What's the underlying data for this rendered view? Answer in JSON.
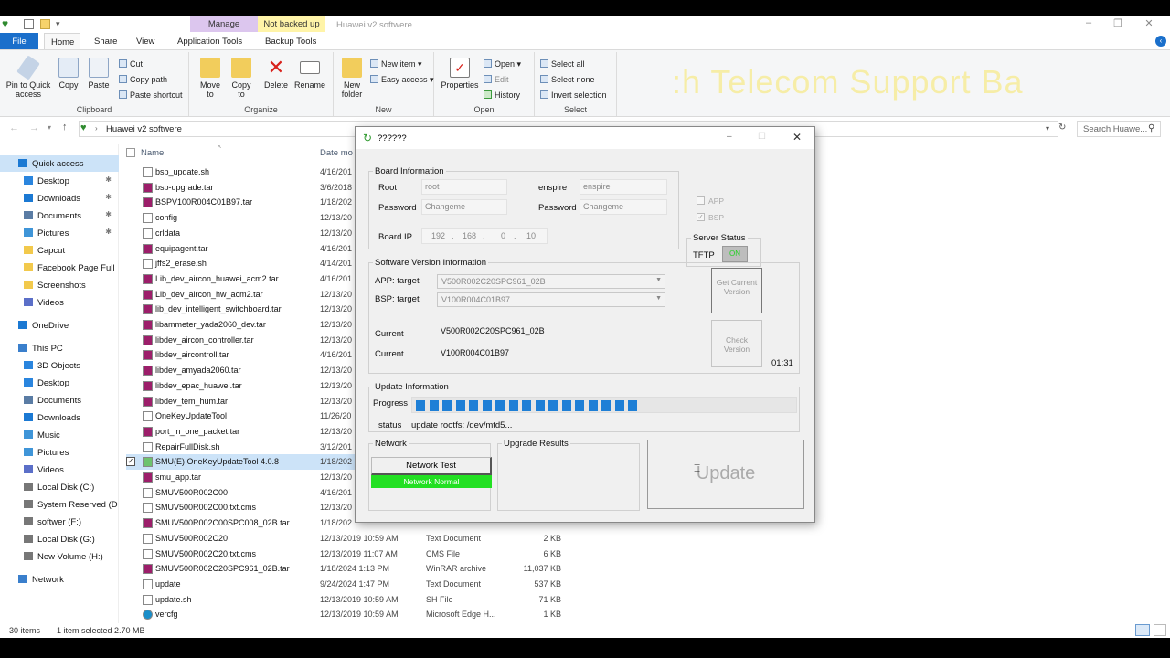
{
  "window": {
    "title": "Huawei v2 softwere",
    "ctx_manage": "Manage",
    "ctx_not_backed": "Not backed up"
  },
  "ribbon": {
    "tabs": [
      "File",
      "Home",
      "Share",
      "View",
      "Application Tools",
      "Backup Tools"
    ],
    "clipboard": {
      "label": "Clipboard",
      "pin": "Pin to Quick access",
      "copy": "Copy",
      "paste": "Paste",
      "cut": "Cut",
      "copy_path": "Copy path",
      "paste_shortcut": "Paste shortcut"
    },
    "organize": {
      "label": "Organize",
      "move": "Move to",
      "copy": "Copy to",
      "delete": "Delete",
      "rename": "Rename"
    },
    "new": {
      "label": "New",
      "folder": "New folder",
      "item": "New item",
      "easy": "Easy access"
    },
    "open": {
      "label": "Open",
      "properties": "Properties",
      "open": "Open",
      "edit": "Edit",
      "history": "History"
    },
    "select": {
      "label": "Select",
      "all": "Select all",
      "none": "Select none",
      "invert": "Invert selection"
    },
    "banner": ":h Telecom Support  Ba"
  },
  "address": {
    "path": "Huawei v2 softwere",
    "search_placeholder": "Search Huawe..."
  },
  "nav": [
    {
      "label": "Quick access",
      "kind": "star",
      "indent": 0,
      "sel": true
    },
    {
      "label": "Desktop",
      "kind": "blue",
      "indent": 1,
      "pin": true
    },
    {
      "label": "Downloads",
      "kind": "down",
      "indent": 1,
      "pin": true
    },
    {
      "label": "Documents",
      "kind": "doc",
      "indent": 1,
      "pin": true
    },
    {
      "label": "Pictures",
      "kind": "pic",
      "indent": 1,
      "pin": true
    },
    {
      "label": "Capcut",
      "kind": "folder",
      "indent": 1
    },
    {
      "label": "Facebook Page Full",
      "kind": "folder",
      "indent": 1
    },
    {
      "label": "Screenshots",
      "kind": "folder",
      "indent": 1
    },
    {
      "label": "Videos",
      "kind": "vid",
      "indent": 1
    },
    {
      "label": "",
      "kind": "gap",
      "indent": 0
    },
    {
      "label": "OneDrive",
      "kind": "cloud",
      "indent": 0
    },
    {
      "label": "",
      "kind": "gap",
      "indent": 0
    },
    {
      "label": "This PC",
      "kind": "pc",
      "indent": 0
    },
    {
      "label": "3D Objects",
      "kind": "blue",
      "indent": 1
    },
    {
      "label": "Desktop",
      "kind": "blue",
      "indent": 1
    },
    {
      "label": "Documents",
      "kind": "doc",
      "indent": 1
    },
    {
      "label": "Downloads",
      "kind": "down",
      "indent": 1
    },
    {
      "label": "Music",
      "kind": "music",
      "indent": 1
    },
    {
      "label": "Pictures",
      "kind": "pic",
      "indent": 1
    },
    {
      "label": "Videos",
      "kind": "vid",
      "indent": 1
    },
    {
      "label": "Local Disk (C:)",
      "kind": "disk",
      "indent": 1
    },
    {
      "label": "System Reserved (D",
      "kind": "disk",
      "indent": 1
    },
    {
      "label": "softwer (F:)",
      "kind": "disk",
      "indent": 1
    },
    {
      "label": "Local Disk (G:)",
      "kind": "disk",
      "indent": 1
    },
    {
      "label": "New Volume (H:)",
      "kind": "disk",
      "indent": 1
    },
    {
      "label": "",
      "kind": "gap",
      "indent": 0
    },
    {
      "label": "Network",
      "kind": "net",
      "indent": 0
    }
  ],
  "list": {
    "col_name": "Name",
    "col_date": "Date mo",
    "files": [
      {
        "name": "bsp_update.sh",
        "date": "4/16/201",
        "type": "",
        "size": "",
        "kind": "sh"
      },
      {
        "name": "bsp-upgrade.tar",
        "date": "3/6/2018",
        "type": "",
        "size": "",
        "kind": "rar"
      },
      {
        "name": "BSPV100R004C01B97.tar",
        "date": "1/18/202",
        "type": "",
        "size": "",
        "kind": "rar"
      },
      {
        "name": "config",
        "date": "12/13/20",
        "type": "",
        "size": "",
        "kind": "file"
      },
      {
        "name": "crldata",
        "date": "12/13/20",
        "type": "",
        "size": "",
        "kind": "file"
      },
      {
        "name": "equipagent.tar",
        "date": "4/16/201",
        "type": "",
        "size": "",
        "kind": "rar"
      },
      {
        "name": "jffs2_erase.sh",
        "date": "4/14/201",
        "type": "",
        "size": "",
        "kind": "sh"
      },
      {
        "name": "Lib_dev_aircon_huawei_acm2.tar",
        "date": "4/16/201",
        "type": "",
        "size": "",
        "kind": "rar"
      },
      {
        "name": "Lib_dev_aircon_hw_acm2.tar",
        "date": "12/13/20",
        "type": "",
        "size": "",
        "kind": "rar"
      },
      {
        "name": "lib_dev_intelligent_switchboard.tar",
        "date": "12/13/20",
        "type": "",
        "size": "",
        "kind": "rar"
      },
      {
        "name": "libammeter_yada2060_dev.tar",
        "date": "12/13/20",
        "type": "",
        "size": "",
        "kind": "rar"
      },
      {
        "name": "libdev_aircon_controller.tar",
        "date": "12/13/20",
        "type": "",
        "size": "",
        "kind": "rar"
      },
      {
        "name": "libdev_aircontroll.tar",
        "date": "4/16/201",
        "type": "",
        "size": "",
        "kind": "rar"
      },
      {
        "name": "libdev_amyada2060.tar",
        "date": "12/13/20",
        "type": "",
        "size": "",
        "kind": "rar"
      },
      {
        "name": "libdev_epac_huawei.tar",
        "date": "12/13/20",
        "type": "",
        "size": "",
        "kind": "rar"
      },
      {
        "name": "libdev_tem_hum.tar",
        "date": "12/13/20",
        "type": "",
        "size": "",
        "kind": "rar"
      },
      {
        "name": "OneKeyUpdateTool",
        "date": "11/26/20",
        "type": "",
        "size": "",
        "kind": "file"
      },
      {
        "name": "port_in_one_packet.tar",
        "date": "12/13/20",
        "type": "",
        "size": "",
        "kind": "rar"
      },
      {
        "name": "RepairFullDisk.sh",
        "date": "3/12/201",
        "type": "",
        "size": "",
        "kind": "sh"
      },
      {
        "name": "SMU(E) OneKeyUpdateTool 4.0.8",
        "date": "1/18/202",
        "type": "",
        "size": "",
        "kind": "exe",
        "sel": true
      },
      {
        "name": "smu_app.tar",
        "date": "12/13/20",
        "type": "",
        "size": "",
        "kind": "rar"
      },
      {
        "name": "SMUV500R002C00",
        "date": "4/16/201",
        "type": "",
        "size": "",
        "kind": "file"
      },
      {
        "name": "SMUV500R002C00.txt.cms",
        "date": "12/13/20",
        "type": "",
        "size": "",
        "kind": "file"
      },
      {
        "name": "SMUV500R002C00SPC008_02B.tar",
        "date": "1/18/202",
        "type": "",
        "size": "",
        "kind": "rar"
      },
      {
        "name": "SMUV500R002C20",
        "date": "12/13/2019 10:59 AM",
        "type": "Text Document",
        "size": "2 KB",
        "kind": "file"
      },
      {
        "name": "SMUV500R002C20.txt.cms",
        "date": "12/13/2019 11:07 AM",
        "type": "CMS File",
        "size": "6 KB",
        "kind": "file"
      },
      {
        "name": "SMUV500R002C20SPC961_02B.tar",
        "date": "1/18/2024 1:13 PM",
        "type": "WinRAR archive",
        "size": "11,037 KB",
        "kind": "rar"
      },
      {
        "name": "update",
        "date": "9/24/2024 1:47 PM",
        "type": "Text Document",
        "size": "537 KB",
        "kind": "file"
      },
      {
        "name": "update.sh",
        "date": "12/13/2019 10:59 AM",
        "type": "SH File",
        "size": "71 KB",
        "kind": "sh"
      },
      {
        "name": "vercfg",
        "date": "12/13/2019 10:59 AM",
        "type": "Microsoft Edge H...",
        "size": "1 KB",
        "kind": "edge"
      }
    ]
  },
  "statusbar": {
    "items": "30 items",
    "selected": "1 item selected  2.70 MB"
  },
  "dialog": {
    "title": "??????",
    "board": {
      "group": "Board Information",
      "root_label": "Root",
      "root_value": "root",
      "enspire_label": "enspire",
      "enspire_value": "enspire",
      "pw_label": "Password",
      "pw_value": "Changeme",
      "pw2_label": "Password",
      "pw2_value": "Changeme",
      "ip_label": "Board IP",
      "ip": [
        "192",
        "168",
        "0",
        "10"
      ]
    },
    "checks": {
      "app": "APP",
      "bsp": "BSP"
    },
    "server": {
      "group": "Server Status",
      "tftp": "TFTP",
      "indicator": "ON"
    },
    "software": {
      "group": "Software Version Information",
      "app_label": "APP:  target",
      "app_target": "V500R002C20SPC961_02B",
      "bsp_label": "BSP:  target",
      "bsp_target": "V100R004C01B97",
      "cur_label": "Current",
      "cur_app": "V500R002C20SPC961_02B",
      "cur_label2": "Current",
      "cur_bsp": "V100R004C01B97"
    },
    "buttons": {
      "get_version": "Get Current Version",
      "check_version": "Check Version",
      "timer": "01:31",
      "update": "Update",
      "network_test": "Network Test"
    },
    "update_info": {
      "group": "Update Information",
      "progress_label": "Progress",
      "progress": 0.6,
      "status_label": "status",
      "status": "update rootfs: /dev/mtd5..."
    },
    "network": {
      "group": "Network",
      "status": "Network Normal"
    },
    "results": {
      "group": "Upgrade Results"
    }
  }
}
